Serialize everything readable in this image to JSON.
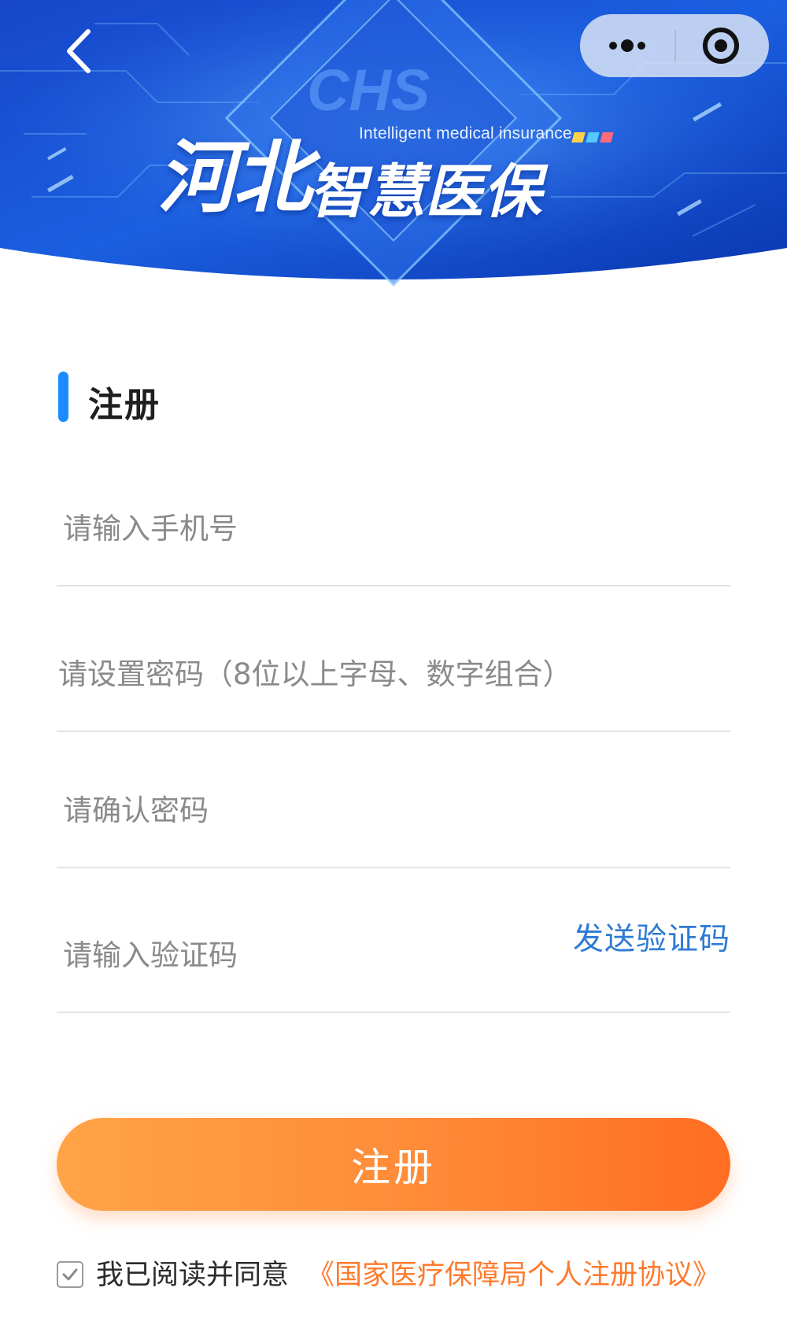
{
  "nav": {
    "back_icon": "chevron-left-icon",
    "more_icon": "more-dots-icon",
    "close_icon": "target-circle-icon"
  },
  "banner": {
    "title_cn_part1": "河北",
    "title_cn_part2": "智慧医保",
    "title_en": "Intelligent medical insurance",
    "colors": {
      "primary": "#1a5fe0",
      "dark": "#0a2a9e",
      "squares": [
        "#ffd24a",
        "#56c8ff",
        "#ff6a7a"
      ]
    }
  },
  "form": {
    "title": "注册",
    "phone_placeholder": "请输入手机号",
    "password_placeholder": "请设置密码（8位以上字母、数字组合）",
    "confirm_placeholder": "请确认密码",
    "code_placeholder": "请输入验证码",
    "send_code_label": "发送验证码",
    "submit_label": "注册",
    "accent_color": "#1a8cff",
    "link_color": "#2f7ad3"
  },
  "agreement": {
    "checked": true,
    "text": "我已阅读并同意",
    "link_text": "《国家医疗保障局个人注册协议》",
    "link_color": "#ff7a2c"
  }
}
